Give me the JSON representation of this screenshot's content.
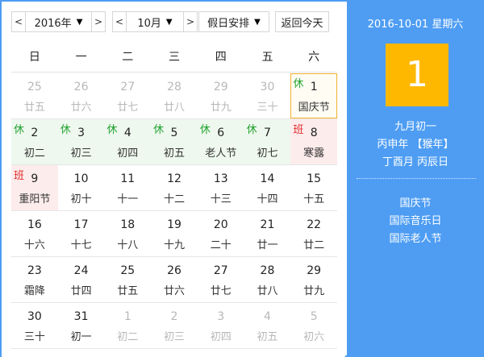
{
  "toolbar": {
    "prev": "<",
    "next": ">",
    "year": "2016年",
    "month": "10月",
    "dropdown": "▼",
    "holiday": "假日安排",
    "today": "返回今天"
  },
  "weekdays": [
    "日",
    "一",
    "二",
    "三",
    "四",
    "五",
    "六"
  ],
  "weeks": [
    [
      {
        "day": "25",
        "lunar": "廿五",
        "tag": "",
        "type": "other"
      },
      {
        "day": "26",
        "lunar": "廿六",
        "tag": "",
        "type": "other"
      },
      {
        "day": "27",
        "lunar": "廿七",
        "tag": "",
        "type": "other"
      },
      {
        "day": "28",
        "lunar": "廿八",
        "tag": "",
        "type": "other"
      },
      {
        "day": "29",
        "lunar": "廿九",
        "tag": "",
        "type": "other"
      },
      {
        "day": "30",
        "lunar": "三十",
        "tag": "",
        "type": "other"
      },
      {
        "day": "1",
        "lunar": "国庆节",
        "tag": "休",
        "type": "selected"
      }
    ],
    [
      {
        "day": "2",
        "lunar": "初二",
        "tag": "休",
        "type": "rest"
      },
      {
        "day": "3",
        "lunar": "初三",
        "tag": "休",
        "type": "rest"
      },
      {
        "day": "4",
        "lunar": "初四",
        "tag": "休",
        "type": "rest"
      },
      {
        "day": "5",
        "lunar": "初五",
        "tag": "休",
        "type": "rest"
      },
      {
        "day": "6",
        "lunar": "老人节",
        "tag": "休",
        "type": "rest"
      },
      {
        "day": "7",
        "lunar": "初七",
        "tag": "休",
        "type": "rest"
      },
      {
        "day": "8",
        "lunar": "寒露",
        "tag": "班",
        "type": "work"
      }
    ],
    [
      {
        "day": "9",
        "lunar": "重阳节",
        "tag": "班",
        "type": "work"
      },
      {
        "day": "10",
        "lunar": "初十",
        "tag": "",
        "type": "normal"
      },
      {
        "day": "11",
        "lunar": "十一",
        "tag": "",
        "type": "normal"
      },
      {
        "day": "12",
        "lunar": "十二",
        "tag": "",
        "type": "normal"
      },
      {
        "day": "13",
        "lunar": "十三",
        "tag": "",
        "type": "normal"
      },
      {
        "day": "14",
        "lunar": "十四",
        "tag": "",
        "type": "normal"
      },
      {
        "day": "15",
        "lunar": "十五",
        "tag": "",
        "type": "normal"
      }
    ],
    [
      {
        "day": "16",
        "lunar": "十六",
        "tag": "",
        "type": "normal"
      },
      {
        "day": "17",
        "lunar": "十七",
        "tag": "",
        "type": "normal"
      },
      {
        "day": "18",
        "lunar": "十八",
        "tag": "",
        "type": "normal"
      },
      {
        "day": "19",
        "lunar": "十九",
        "tag": "",
        "type": "normal"
      },
      {
        "day": "20",
        "lunar": "二十",
        "tag": "",
        "type": "normal"
      },
      {
        "day": "21",
        "lunar": "廿一",
        "tag": "",
        "type": "normal"
      },
      {
        "day": "22",
        "lunar": "廿二",
        "tag": "",
        "type": "normal"
      }
    ],
    [
      {
        "day": "23",
        "lunar": "霜降",
        "tag": "",
        "type": "normal"
      },
      {
        "day": "24",
        "lunar": "廿四",
        "tag": "",
        "type": "normal"
      },
      {
        "day": "25",
        "lunar": "廿五",
        "tag": "",
        "type": "normal"
      },
      {
        "day": "26",
        "lunar": "廿六",
        "tag": "",
        "type": "normal"
      },
      {
        "day": "27",
        "lunar": "廿七",
        "tag": "",
        "type": "normal"
      },
      {
        "day": "28",
        "lunar": "廿八",
        "tag": "",
        "type": "normal"
      },
      {
        "day": "29",
        "lunar": "廿九",
        "tag": "",
        "type": "normal"
      }
    ],
    [
      {
        "day": "30",
        "lunar": "三十",
        "tag": "",
        "type": "normal"
      },
      {
        "day": "31",
        "lunar": "初一",
        "tag": "",
        "type": "normal"
      },
      {
        "day": "1",
        "lunar": "初二",
        "tag": "",
        "type": "other"
      },
      {
        "day": "2",
        "lunar": "初三",
        "tag": "",
        "type": "other"
      },
      {
        "day": "3",
        "lunar": "初四",
        "tag": "",
        "type": "other"
      },
      {
        "day": "4",
        "lunar": "初五",
        "tag": "",
        "type": "other"
      },
      {
        "day": "5",
        "lunar": "初六",
        "tag": "",
        "type": "other"
      }
    ]
  ],
  "sidebar": {
    "date_line": "2016-10-01 星期六",
    "big_day": "1",
    "lunar_date": "九月初一",
    "ganzhi_year": "丙申年 【猴年】",
    "ganzhi_month_day": "丁酉月 丙辰日",
    "festivals": [
      "国庆节",
      "国际音乐日",
      "国际老人节"
    ]
  },
  "colors": {
    "sidebar_bg": "#4e9df3",
    "day_highlight": "#ffb800",
    "rest_tag": "#22a330",
    "work_tag": "#e02a2a",
    "rest_bg": "#eef8ee",
    "work_bg": "#fdecec"
  }
}
